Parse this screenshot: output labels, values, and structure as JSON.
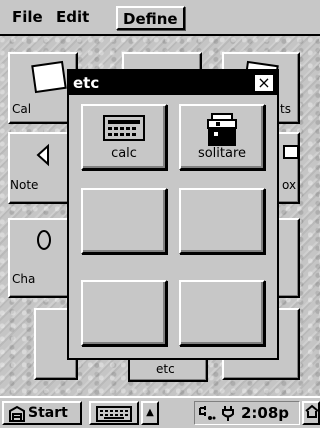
{
  "menubar": {
    "file": "File",
    "edit": "Edit",
    "define": "Define"
  },
  "desktop": {
    "tiles": [
      "Cal",
      "ts",
      "Note",
      "ox",
      "Cha",
      "etc"
    ]
  },
  "popup": {
    "title": "etc",
    "close_glyph": "×",
    "buttons": [
      {
        "label": "calc",
        "icon": "calculator-icon"
      },
      {
        "label": "solitare",
        "icon": "solitaire-icon"
      },
      {
        "label": "",
        "icon": ""
      },
      {
        "label": "",
        "icon": ""
      },
      {
        "label": "",
        "icon": ""
      },
      {
        "label": "",
        "icon": ""
      }
    ]
  },
  "taskbar": {
    "start_label": "Start",
    "up_arrow": "▲",
    "clock": "2:08p"
  },
  "colors": {
    "face": "#c7c7c7",
    "titlebar": "#000000",
    "text": "#000000"
  }
}
